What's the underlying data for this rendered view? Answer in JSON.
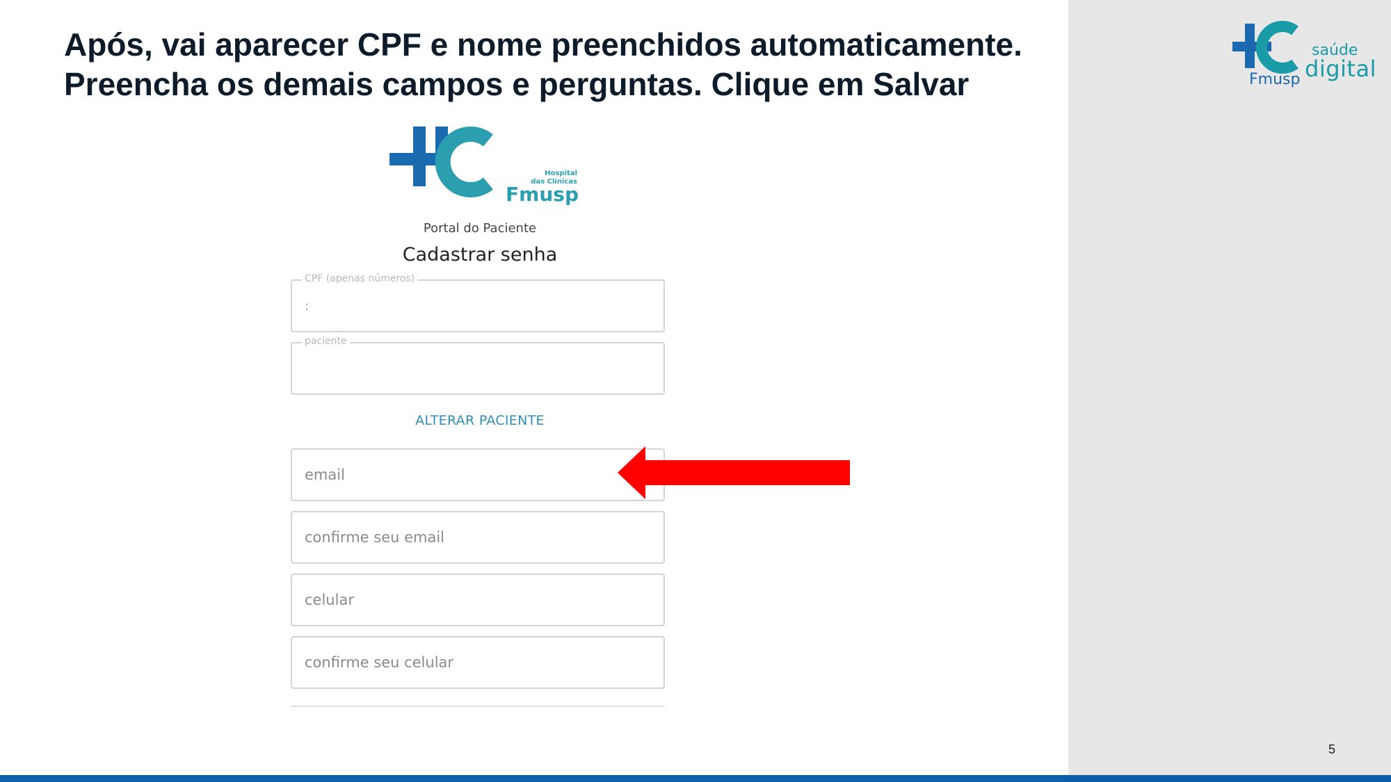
{
  "slide": {
    "title_line1": "Após, vai aparecer CPF e nome preenchidos automaticamente.",
    "title_line2": "Preencha os demais campos e perguntas. Clique em Salvar",
    "page_number": "5"
  },
  "corner_logo": {
    "line1": "saúde",
    "line2": "digital",
    "line3": "Fmusp"
  },
  "portal": {
    "logo_small_text": [
      "Hospital",
      "das Clínicas"
    ],
    "logo_fmusp": "Fmusp",
    "subtitle": "Portal do Paciente",
    "title": "Cadastrar senha",
    "fields": {
      "cpf_label": "CPF (apenas números)",
      "cpf_value": ":",
      "paciente_label": "paciente",
      "email_placeholder": "email",
      "confirm_email_placeholder": "confirme seu email",
      "celular_placeholder": "celular",
      "confirm_celular_placeholder": "confirme seu celular"
    },
    "alter_button": "ALTERAR PACIENTE"
  },
  "colors": {
    "accent_blue": "#0b5ea8",
    "teal": "#1a9ba8",
    "arrow_red": "#ff0000",
    "panel_gray": "#e7e7e8"
  },
  "icons": [
    "hc-logo-icon",
    "red-arrow-icon"
  ]
}
